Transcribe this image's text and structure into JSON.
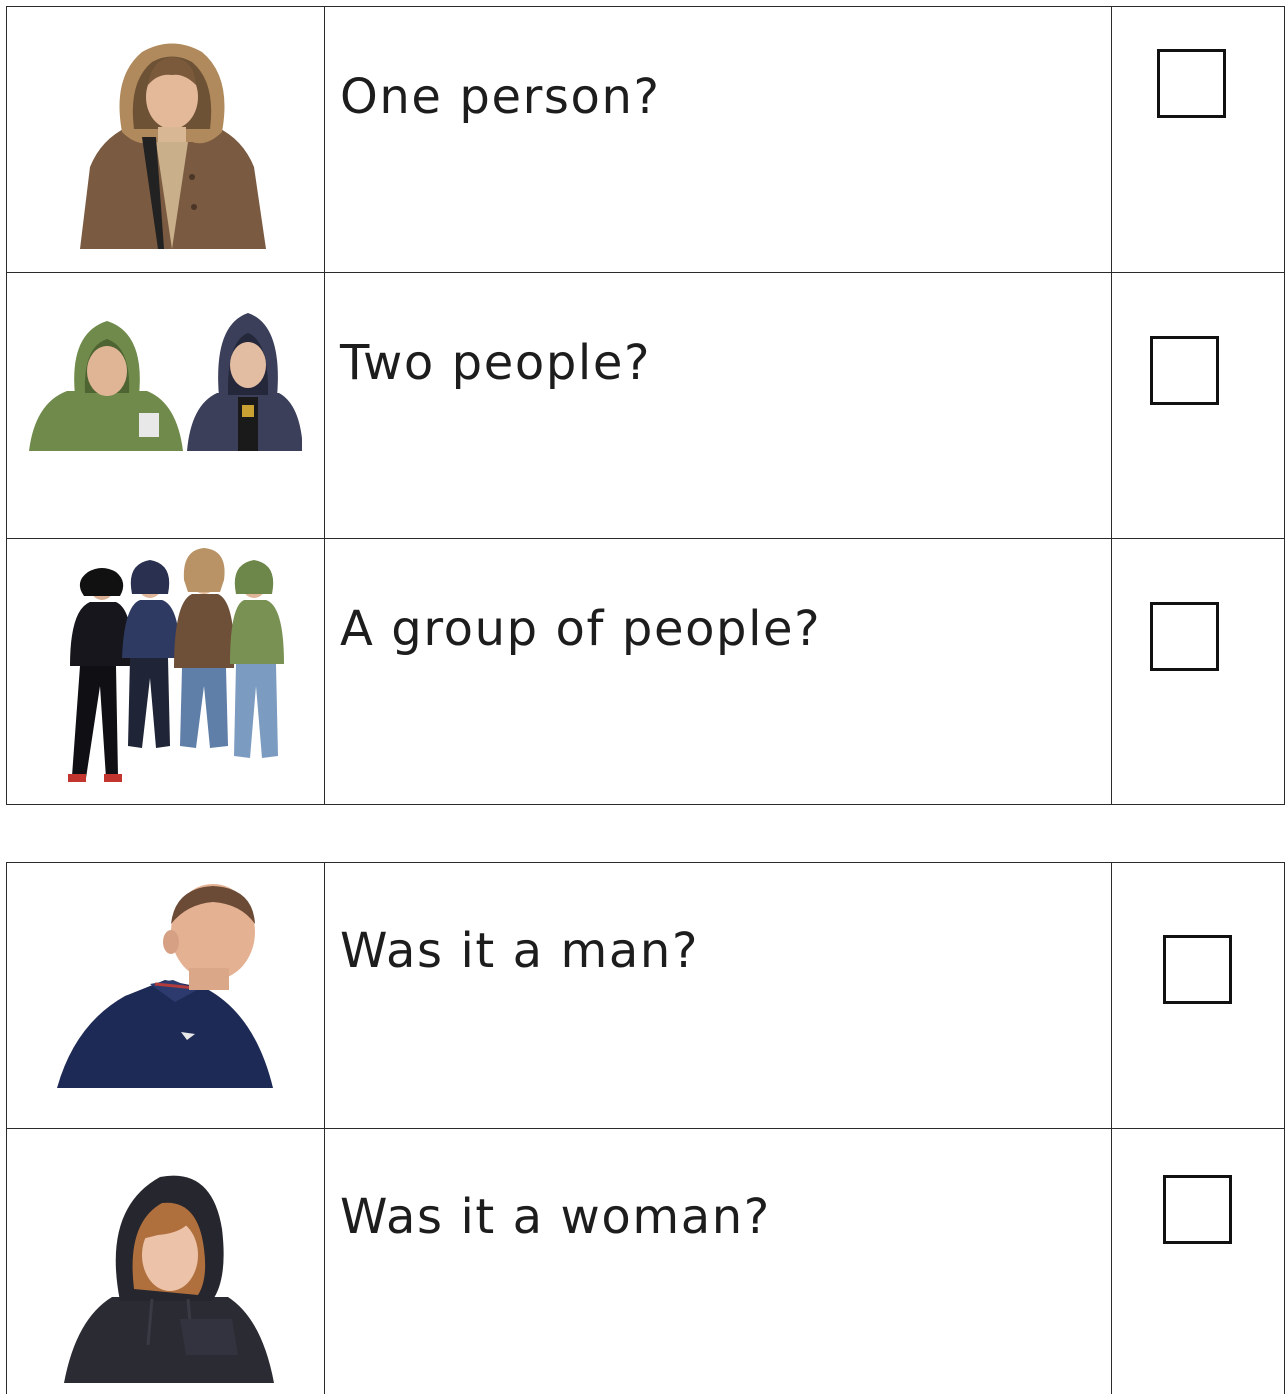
{
  "questions_number": [
    {
      "id": "one-person",
      "label": "One person?",
      "picture": "one-person-icon"
    },
    {
      "id": "two-people",
      "label": "Two people?",
      "picture": "two-people-icon"
    },
    {
      "id": "group",
      "label": "A group of people?",
      "picture": "group-of-people-icon"
    }
  ],
  "questions_gender": [
    {
      "id": "man",
      "label": "Was it a man?",
      "picture": "man-icon"
    },
    {
      "id": "woman",
      "label": "Was it a woman?",
      "picture": "woman-icon"
    }
  ],
  "colors": {
    "border": "#2b2b2b",
    "checkbox_border": "#111111",
    "text": "#1d1d1d"
  }
}
